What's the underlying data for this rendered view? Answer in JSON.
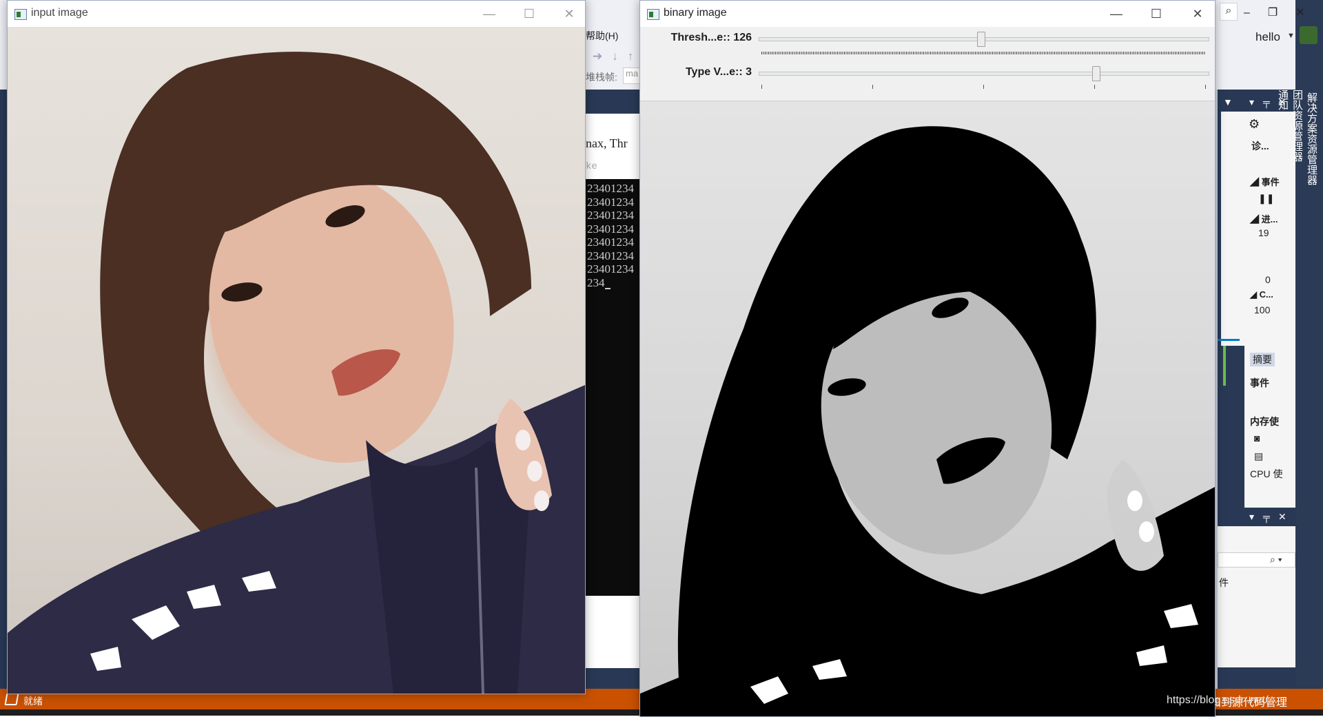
{
  "vs": {
    "help_menu": "帮助(H)",
    "stack_label": "堆栈帧:",
    "stack_input": "ma",
    "console_header": "nax, Thr",
    "console_hint": "ke",
    "console_lines": [
      "23401234",
      "23401234",
      "23401234",
      "23401234",
      "23401234",
      "23401234",
      "23401234",
      "234"
    ],
    "status_text": "就绪",
    "status_right": "添加到源代码管理",
    "user_name": "hello",
    "vertical_tabs": [
      "解决方案资源管理器",
      "团队资源管理器",
      "通知"
    ],
    "diag_panel": {
      "title": "诊...",
      "events_header": "事件",
      "process_header": "进...",
      "val_19": "19",
      "val_0": "0",
      "cpu_header": "C...",
      "val_100": "100"
    },
    "panel2": {
      "summary_tab": "摘要",
      "events": "事件",
      "memory": "内存使",
      "cpu": "CPU 使"
    },
    "panel3_label": "件"
  },
  "input_window": {
    "title": "input image"
  },
  "binary_window": {
    "title": "binary image",
    "trackbars": [
      {
        "label": "Thresh...e:: 126",
        "value": 126,
        "max": 255
      },
      {
        "label": "Type V...e:: 3",
        "value": 3,
        "max": 4
      }
    ]
  },
  "watermark": "https://blog.csdn.net/..."
}
